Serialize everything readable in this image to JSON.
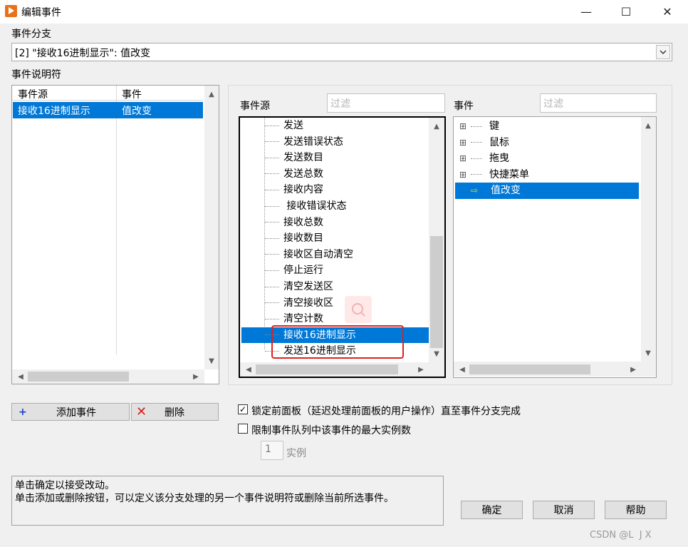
{
  "window": {
    "title": "编辑事件",
    "minimize": "—",
    "maximize": "☐",
    "close": "✕"
  },
  "event_branch": {
    "label": "事件分支",
    "value": "[2] \"接收16进制显示\": 值改变"
  },
  "descriptor": {
    "label": "事件说明符",
    "col_source": "事件源",
    "col_event": "事件",
    "rows": [
      {
        "source": "接收16进制显示",
        "event": "值改变"
      }
    ]
  },
  "sources": {
    "label": "事件源",
    "filter_placeholder": "过滤",
    "items": [
      "发送",
      "发送错误状态",
      "发送数目",
      "发送总数",
      "接收内容",
      " 接收错误状态",
      "接收总数",
      "接收数目",
      "接收区自动清空",
      "停止运行",
      "清空发送区",
      "清空接收区",
      "清空计数",
      "接收16进制显示",
      "发送16进制显示"
    ],
    "selected_index": 13
  },
  "events": {
    "label": "事件",
    "filter_placeholder": "过滤",
    "items": [
      {
        "label": "键",
        "expand": "⊞"
      },
      {
        "label": "鼠标",
        "expand": "⊞"
      },
      {
        "label": "拖曳",
        "expand": "⊞"
      },
      {
        "label": "快捷菜单",
        "expand": "⊞"
      },
      {
        "label": "值改变",
        "expand": "⇨"
      }
    ],
    "selected_index": 4
  },
  "buttons": {
    "add": "添加事件",
    "add_icon": "+",
    "delete": "删除",
    "delete_icon": "✕",
    "ok": "确定",
    "cancel": "取消",
    "help": "帮助"
  },
  "options": {
    "lock_panel": {
      "label": "锁定前面板（延迟处理前面板的用户操作）直至事件分支完成",
      "checked": true,
      "mark": "✓"
    },
    "limit_queue": {
      "label": "限制事件队列中该事件的最大实例数",
      "checked": false
    },
    "instances_value": "1",
    "instances_label": "实例"
  },
  "help_text": {
    "line1": "单击确定以接受改动。",
    "line2": "单击添加或删除按钮，可以定义该分支处理的另一个事件说明符或删除当前所选事件。"
  },
  "watermark": "CSDN @L  J X",
  "colors": {
    "selection": "#0078d7",
    "highlight_box": "#e02020",
    "app_icon": "#e8721c"
  }
}
